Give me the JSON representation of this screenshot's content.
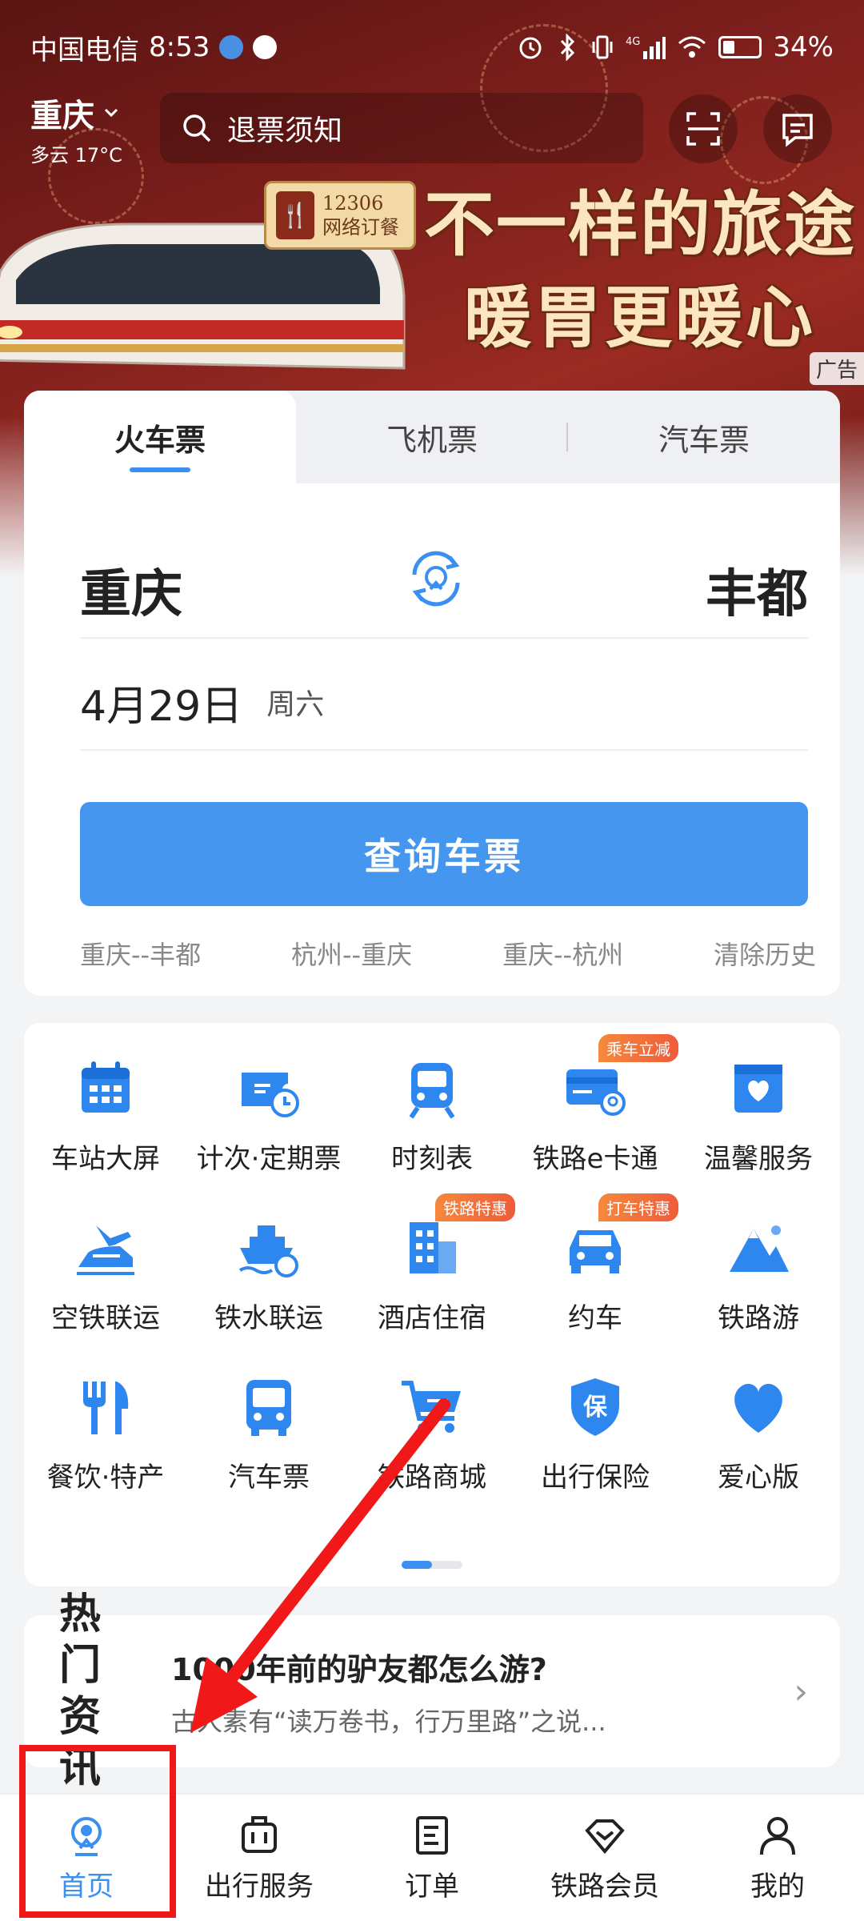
{
  "status_bar": {
    "carrier": "中国电信",
    "time": "8:53",
    "battery": "34%",
    "battery_level": 0.34
  },
  "header": {
    "city": "重庆",
    "weather": "多云 17°C",
    "search_placeholder": "退票须知",
    "icons": [
      "scan-icon",
      "message-icon"
    ]
  },
  "banner": {
    "badge_line1": "12306",
    "badge_line2": "网络订餐",
    "slogan_line1": "不一样的旅途",
    "slogan_line2": "暖胃更暖心",
    "ad_label": "广告"
  },
  "ticket": {
    "tabs": [
      "火车票",
      "飞机票",
      "汽车票"
    ],
    "active_tab": 0,
    "from": "重庆",
    "to": "丰都",
    "date": "4月29日",
    "weekday": "周六",
    "query_button": "查询车票",
    "history": [
      "重庆--丰都",
      "杭州--重庆",
      "重庆--杭州"
    ],
    "clear_history": "清除历史"
  },
  "services": [
    {
      "label": "车站大屏",
      "icon": "calendar-icon",
      "tag": ""
    },
    {
      "label": "计次·定期票",
      "icon": "ticket-clock-icon",
      "tag": ""
    },
    {
      "label": "时刻表",
      "icon": "train-icon",
      "tag": ""
    },
    {
      "label": "铁路e卡通",
      "icon": "card-icon",
      "tag": "乘车立减"
    },
    {
      "label": "温馨服务",
      "icon": "heart-box-icon",
      "tag": ""
    },
    {
      "label": "空铁联运",
      "icon": "plane-train-icon",
      "tag": ""
    },
    {
      "label": "铁水联运",
      "icon": "ship-icon",
      "tag": ""
    },
    {
      "label": "酒店住宿",
      "icon": "hotel-icon",
      "tag": "铁路特惠"
    },
    {
      "label": "约车",
      "icon": "car-icon",
      "tag": "打车特惠"
    },
    {
      "label": "铁路游",
      "icon": "mountain-icon",
      "tag": ""
    },
    {
      "label": "餐饮·特产",
      "icon": "fork-knife-icon",
      "tag": ""
    },
    {
      "label": "汽车票",
      "icon": "bus-icon",
      "tag": ""
    },
    {
      "label": "铁路商城",
      "icon": "cart-icon",
      "tag": ""
    },
    {
      "label": "出行保险",
      "icon": "shield-icon",
      "tag": ""
    },
    {
      "label": "爱心版",
      "icon": "heart-icon",
      "tag": ""
    }
  ],
  "news": {
    "title_line1": "热门",
    "title_line2": "资讯",
    "headline": "1000年前的驴友都怎么游?",
    "summary": "古人素有“读万卷书，行万里路”之说..."
  },
  "bottom_nav": [
    {
      "label": "首页",
      "icon": "home-train-icon",
      "active": true
    },
    {
      "label": "出行服务",
      "icon": "luggage-icon",
      "active": false
    },
    {
      "label": "订单",
      "icon": "order-icon",
      "active": false
    },
    {
      "label": "铁路会员",
      "icon": "diamond-icon",
      "active": false
    },
    {
      "label": "我的",
      "icon": "user-icon",
      "active": false
    }
  ],
  "colors": {
    "accent": "#3a8ff0",
    "button": "#4596ef",
    "annotation": "#f01818"
  }
}
